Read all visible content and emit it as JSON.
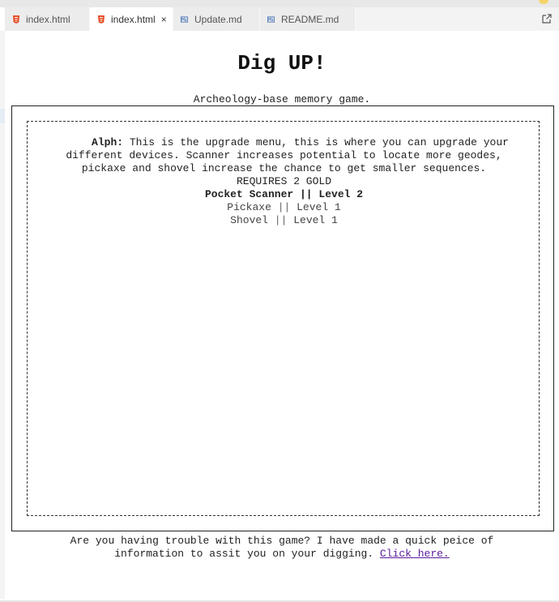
{
  "tabs": [
    {
      "label": "index.html",
      "icon": "html5-icon",
      "active": false
    },
    {
      "label": "index.html",
      "icon": "html5-icon",
      "active": true,
      "close": "×"
    },
    {
      "label": "Update.md",
      "icon": "markdown-icon",
      "active": false
    },
    {
      "label": "README.md",
      "icon": "markdown-icon",
      "active": false
    }
  ],
  "page": {
    "title": "Dig UP!",
    "subtitle": "Archeology-base memory game."
  },
  "dialog": {
    "speaker": "Alph:",
    "message": "This is the upgrade menu, this is where you can upgrade your different devices. Scanner increases potential to locate more geodes, pickaxe and shovel increase the chance to get smaller sequences.",
    "requirement": "REQUIRES 2 GOLD",
    "upgrades": [
      {
        "name": "Pocket Scanner",
        "separator": "||",
        "level": "Level 2"
      },
      {
        "name": "Pickaxe",
        "separator": "||",
        "level": "Level 1"
      },
      {
        "name": "Shovel",
        "separator": "||",
        "level": "Level 1"
      }
    ]
  },
  "footer": {
    "text": "Are you having trouble with this game? I have made a quick peice of information to assit you on your digging.",
    "link": "Click here."
  },
  "colors": {
    "html_icon": "#e44d26",
    "md_icon": "#4a76b8",
    "link": "#5a1a9b"
  }
}
